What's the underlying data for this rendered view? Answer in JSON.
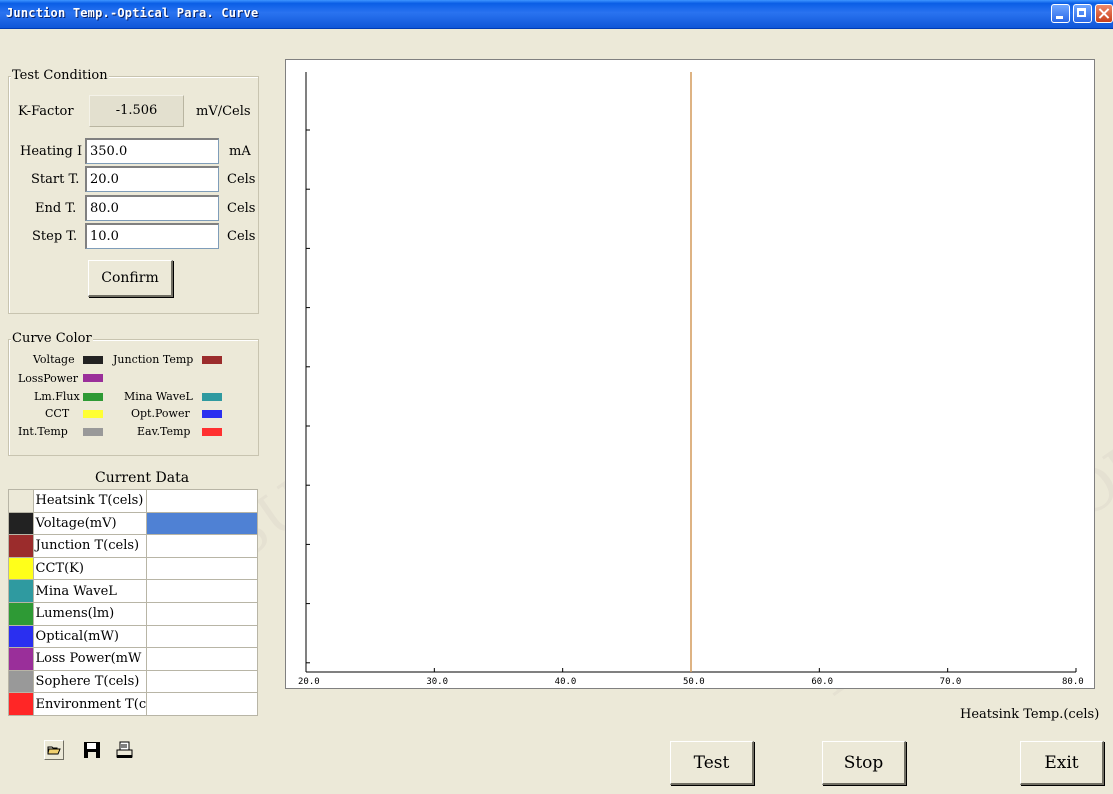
{
  "window": {
    "title": "Junction Temp.-Optical Para. Curve"
  },
  "test_condition": {
    "title": "Test Condition",
    "k_factor_label": "K-Factor",
    "k_factor_value": "-1.506",
    "k_factor_unit": "mV/Cels",
    "fields": [
      {
        "label": "Heating I",
        "value": "350.0",
        "unit": "mA"
      },
      {
        "label": "Start T.",
        "value": "20.0",
        "unit": "Cels"
      },
      {
        "label": "End T.",
        "value": "80.0",
        "unit": "Cels"
      },
      {
        "label": "Step T.",
        "value": "10.0",
        "unit": "Cels"
      }
    ],
    "confirm_label": "Confirm"
  },
  "curve_color": {
    "title": "Curve Color",
    "items": [
      {
        "label": "Voltage",
        "color": "#222222"
      },
      {
        "label": "Junction Temp",
        "color": "#9b2c2c"
      },
      {
        "label": "LossPower",
        "color": "#9a2f9a"
      },
      {
        "label": "Lm.Flux",
        "color": "#2e9a35"
      },
      {
        "label": "Mina WaveL",
        "color": "#2f9aa0"
      },
      {
        "label": "CCT",
        "color": "#ffff33"
      },
      {
        "label": "Opt.Power",
        "color": "#2a2ff0"
      },
      {
        "label": "Int.Temp",
        "color": "#999999"
      },
      {
        "label": "Eav.Temp",
        "color": "#ff3030"
      }
    ]
  },
  "current_data": {
    "title": "Current Data",
    "rows": [
      {
        "name": "Heatsink T(cels)",
        "color": "#ece9d8",
        "value": "",
        "selected": false
      },
      {
        "name": "Voltage(mV)",
        "color": "#222222",
        "value": "",
        "selected": true
      },
      {
        "name": "Junction T(cels)",
        "color": "#9b2c2c",
        "value": "",
        "selected": false
      },
      {
        "name": "CCT(K)",
        "color": "#ffff1a",
        "value": "",
        "selected": false
      },
      {
        "name": "Mina WaveL",
        "color": "#2f9aa0",
        "value": "",
        "selected": false
      },
      {
        "name": "Lumens(lm)",
        "color": "#2e9a35",
        "value": "",
        "selected": false
      },
      {
        "name": "Optical(mW)",
        "color": "#2a2ff0",
        "value": "",
        "selected": false
      },
      {
        "name": "Loss Power(mW",
        "color": "#9a2f9a",
        "value": "",
        "selected": false
      },
      {
        "name": "Sophere T(cels)",
        "color": "#999999",
        "value": "",
        "selected": false
      },
      {
        "name": "Environment T(c",
        "color": "#ff2626",
        "value": "",
        "selected": false
      }
    ],
    "selected_color": "#4f81d4"
  },
  "toolbar": {
    "icons": [
      "open-folder-icon",
      "save-disk-icon",
      "print-icon"
    ]
  },
  "chart_data": {
    "type": "line",
    "xlabel": "Heatsink Temp.(cels)",
    "ylabel": "",
    "xlim": [
      20,
      80
    ],
    "x_ticks": [
      "20.0",
      "30.0",
      "40.0",
      "50.0",
      "60.0",
      "70.0",
      "80.0"
    ],
    "y_tick_count": 10,
    "marker_x": 50,
    "marker_color": "#d39a5a",
    "series": []
  },
  "buttons": {
    "test": "Test",
    "stop": "Stop",
    "exit": "Exit"
  },
  "watermark": {
    "text1": "LISUN GROUP",
    "text2": "www.Lisungroup.com"
  }
}
